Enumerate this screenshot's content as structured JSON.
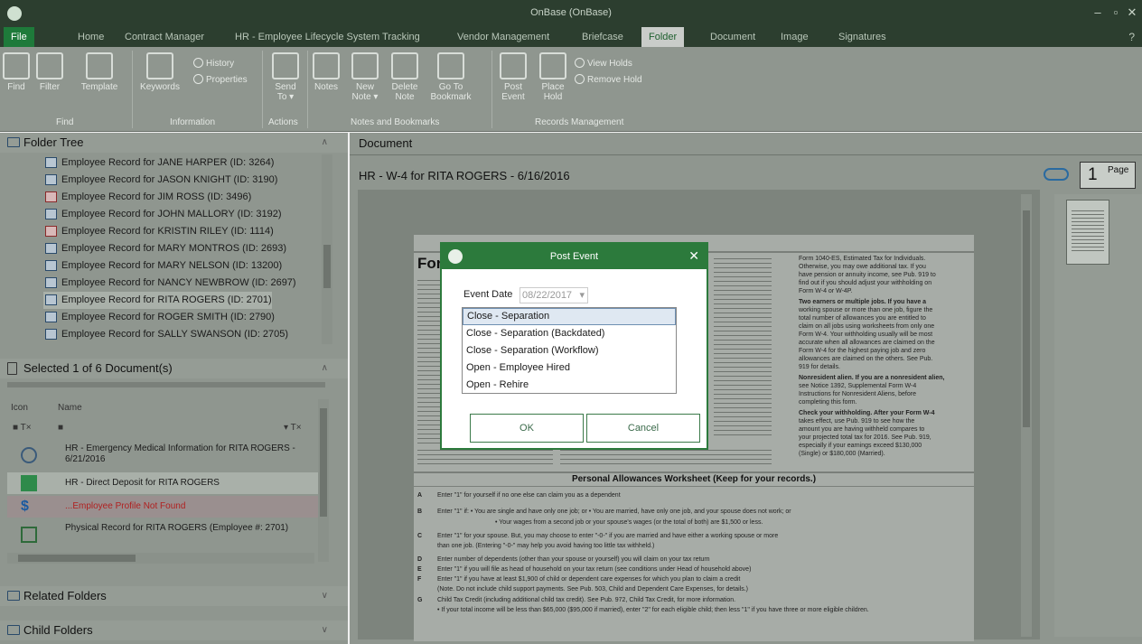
{
  "window": {
    "title": "OnBase (OnBase)",
    "min": "–",
    "max": "▫",
    "close": "✕"
  },
  "tabs": [
    {
      "label": "File"
    },
    {
      "label": "Home"
    },
    {
      "label": "Contract Manager"
    },
    {
      "label": "HR - Employee Lifecycle System Tracking"
    },
    {
      "label": "Vendor Management"
    },
    {
      "label": "Briefcase"
    },
    {
      "label": "Folder"
    },
    {
      "label": "Document"
    },
    {
      "label": "Image"
    },
    {
      "label": "Signatures"
    }
  ],
  "help": "?",
  "ribbon": {
    "find": "Find",
    "filter": "Filter",
    "template": "Template",
    "keywords": "Keywords",
    "history": "History",
    "properties": "Properties",
    "send_to_1": "Send",
    "send_to_2": "To ▾",
    "notes": "Notes",
    "new_note_1": "New",
    "new_note_2": "Note ▾",
    "delete_note_1": "Delete",
    "delete_note_2": "Note",
    "goto_bm_1": "Go To",
    "goto_bm_2": "Bookmark",
    "post_event_1": "Post",
    "post_event_2": "Event",
    "place_hold_1": "Place",
    "place_hold_2": "Hold",
    "view_holds": "View Holds",
    "remove_hold": "Remove Hold",
    "groups": {
      "find": "Find",
      "information": "Information",
      "actions": "Actions",
      "notes": "Notes and Bookmarks",
      "records": "Records Management"
    }
  },
  "folder_tree": {
    "title": "Folder Tree",
    "items": [
      {
        "label": "Employee Record for JANE HARPER (ID: 3264)"
      },
      {
        "label": "Employee Record for JASON KNIGHT (ID: 3190)"
      },
      {
        "label": "Employee Record for JIM ROSS (ID: 3496)"
      },
      {
        "label": "Employee Record for JOHN MALLORY (ID: 3192)"
      },
      {
        "label": "Employee Record for KRISTIN RILEY (ID: 1114)"
      },
      {
        "label": "Employee Record for MARY MONTROS (ID: 2693)"
      },
      {
        "label": "Employee Record for MARY NELSON (ID: 13200)"
      },
      {
        "label": "Employee Record for NANCY NEWBROW (ID: 2697)"
      },
      {
        "label": "Employee Record for RITA ROGERS (ID: 2701)"
      },
      {
        "label": "Employee Record for ROGER SMITH (ID: 2790)"
      },
      {
        "label": "Employee Record for SALLY SWANSON (ID: 2705)"
      }
    ]
  },
  "selected": {
    "title": "Selected 1 of 6 Document(s)",
    "col_icon": "Icon",
    "col_name": "Name",
    "docs": [
      {
        "name": "HR - Emergency Medical Information for RITA ROGERS - 6/21/2016"
      },
      {
        "name": "HR - Direct Deposit for RITA ROGERS"
      },
      {
        "name": "...Employee Profile Not Found"
      },
      {
        "name": "Physical Record for RITA ROGERS (Employee #: 2701)"
      }
    ]
  },
  "related_folders": "Related Folders",
  "child_folders": "Child Folders",
  "document": {
    "header": "Document",
    "title": "HR - W-4 for RITA ROGERS - 6/16/2016",
    "page_num": "1",
    "page_label": "Page"
  },
  "form": {
    "heading": "For",
    "worksheet_title": "Personal Allowances Worksheet (Keep for your records.)",
    "lines": [
      {
        "letter": "A",
        "text": "Enter \"1\" for yourself if no one else can claim you as a dependent"
      },
      {
        "letter": "B",
        "text": "Enter \"1\" if:  • You are single and have only one job; or  • You are married, have only one job, and your spouse does not work; or"
      },
      {
        "letter": "",
        "text": "• Your wages from a second job or your spouse's wages (or the total of both) are $1,500 or less."
      },
      {
        "letter": "C",
        "text": "Enter \"1\" for your spouse. But, you may choose to enter \"-0-\" if you are married and have either a working spouse or more"
      },
      {
        "letter": "",
        "text": "than one job. (Entering \"-0-\" may help you avoid having too little tax withheld.)"
      },
      {
        "letter": "D",
        "text": "Enter number of dependents (other than your spouse or yourself) you will claim on your tax return"
      },
      {
        "letter": "E",
        "text": "Enter \"1\" if you will file as head of household on your tax return (see conditions under Head of household above)"
      },
      {
        "letter": "F",
        "text": "Enter \"1\" if you have at least $1,900 of child or dependent care expenses for which you plan to claim a credit"
      },
      {
        "letter": "",
        "text": "(Note. Do not include child support payments. See Pub. 503, Child and Dependent Care Expenses, for details.)"
      },
      {
        "letter": "G",
        "text": "Child Tax Credit (including additional child tax credit). See Pub. 972, Child Tax Credit, for more information."
      },
      {
        "letter": "",
        "text": "• If your total income will be less than $65,000 ($95,000 if married), enter \"2\" for each eligible child; then less \"1\" if you have three or more eligible children."
      }
    ],
    "right_col": [
      {
        "text": "Form 1040-ES, Estimated Tax for Individuals."
      },
      {
        "text": "Otherwise, you may owe additional tax. If you"
      },
      {
        "text": "have pension or annuity income, see Pub. 919 to"
      },
      {
        "text": "find out if you should adjust your withholding on"
      },
      {
        "text": "Form W-4 or W-4P."
      },
      {
        "text": "Two earners or multiple jobs. If you have a"
      },
      {
        "text": "working spouse or more than one job, figure the"
      },
      {
        "text": "total number of allowances you are entitled to"
      },
      {
        "text": "claim on all jobs using worksheets from only one"
      },
      {
        "text": "Form W-4. Your withholding usually will be most"
      },
      {
        "text": "accurate when all allowances are claimed on the"
      },
      {
        "text": "Form W-4 for the highest paying job and zero"
      },
      {
        "text": "allowances are claimed on the others. See Pub."
      },
      {
        "text": "919 for details."
      },
      {
        "text": "Nonresident alien. If you are a nonresident alien,"
      },
      {
        "text": "see Notice 1392, Supplemental Form W-4"
      },
      {
        "text": "Instructions for Nonresident Aliens, before"
      },
      {
        "text": "completing this form."
      },
      {
        "text": "Check your withholding. After your Form W-4"
      },
      {
        "text": "takes effect, use Pub. 919 to see how the"
      },
      {
        "text": "amount you are having withheld compares to"
      },
      {
        "text": "your projected total tax for 2016. See Pub. 919,"
      },
      {
        "text": "especially if your earnings exceed $130,000"
      },
      {
        "text": "(Single) or $180,000 (Married)."
      }
    ]
  },
  "dialog": {
    "title": "Post Event",
    "date_label": "Event Date",
    "date_value": "08/22/2017",
    "options": [
      {
        "label": "Close - Separation"
      },
      {
        "label": "Close - Separation (Backdated)"
      },
      {
        "label": "Close - Separation (Workflow)"
      },
      {
        "label": "Open - Employee Hired"
      },
      {
        "label": "Open - Rehire"
      }
    ],
    "ok": "OK",
    "cancel": "Cancel"
  }
}
